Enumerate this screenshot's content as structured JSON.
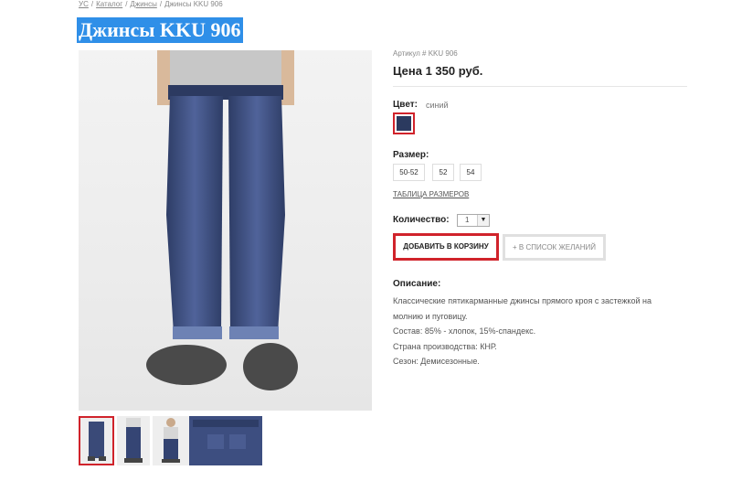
{
  "breadcrumb": [
    "УС",
    "Каталог",
    "Джинсы",
    "Джинсы KKU 906"
  ],
  "title": "Джинсы KKU 906",
  "product": {
    "sku_label": "Артикул # KKU 906",
    "price_label": "Цена 1 350 руб.",
    "color_label": "Цвет:",
    "color_value": "синий",
    "color_hex": "#2b3a5f",
    "size_label": "Размер:",
    "sizes": [
      "50-52",
      "52",
      "54"
    ],
    "size_table_link": "ТАБЛИЦА РАЗМЕРОВ",
    "qty_label": "Количество:",
    "qty_value": "1",
    "add_to_cart": "ДОБАВИТЬ В КОРЗИНУ",
    "wishlist": "+ В СПИСОК ЖЕЛАНИЙ"
  },
  "description": {
    "title": "Описание:",
    "lines": [
      "Классические пятикарманные джинсы прямого кроя с застежкой на",
      "молнию и пуговицу.",
      "Состав: 85% - хлопок, 15%-спандекс.",
      "Страна производства: КНР.",
      "Сезон: Демисезонные."
    ]
  },
  "colors": {
    "accent": "#d0232b",
    "title_bg": "#2f8fe8"
  }
}
